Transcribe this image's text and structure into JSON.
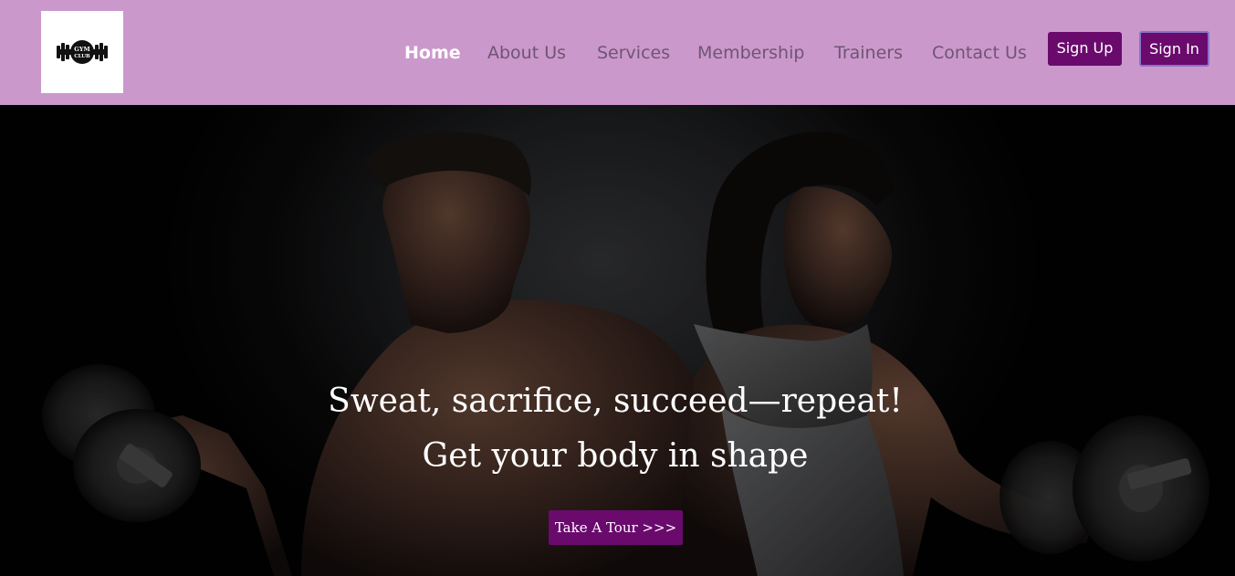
{
  "logo": {
    "text_top": "GYM",
    "text_bottom": "CLUB",
    "icon": "dumbbell-logo-icon"
  },
  "nav": {
    "items": [
      {
        "label": "Home",
        "active": true
      },
      {
        "label": "About Us",
        "active": false
      },
      {
        "label": "Services",
        "active": false
      },
      {
        "label": "Membership",
        "active": false
      },
      {
        "label": "Trainers",
        "active": false
      },
      {
        "label": "Contact Us",
        "active": false
      }
    ],
    "signup_label": "Sign Up",
    "signin_label": "Sign In"
  },
  "hero": {
    "title": "Sweat, sacrifice, succeed—repeat!",
    "subtitle": "Get your body in shape",
    "cta_label": "Take A Tour >>>"
  },
  "colors": {
    "navbar_bg": "#cb98cc",
    "nav_text": "#6e5573",
    "nav_active": "#ffffff",
    "button_bg": "#6a0a6d",
    "signin_border": "#8a72c9"
  }
}
